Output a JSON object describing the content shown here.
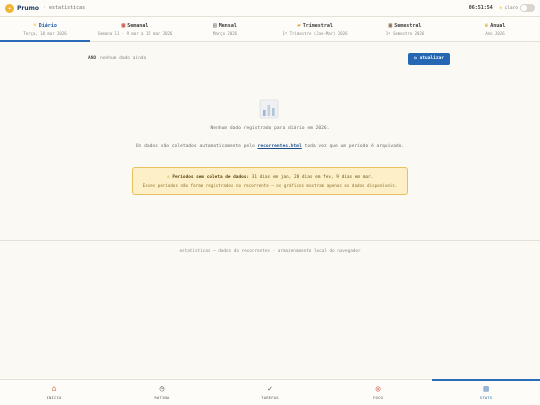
{
  "app": {
    "name": "Prumo",
    "separator": "·",
    "section": "estatísticas"
  },
  "header": {
    "clock": "06:51:54",
    "theme_label": "claro",
    "theme_icon": "sun-icon"
  },
  "tabs": [
    {
      "label": "Diário",
      "sub": "Terça, 10 mar 2026",
      "icon": "sun-icon",
      "active": true
    },
    {
      "label": "Semanal",
      "sub": "Semana 11 · 9 mar a 15 mar 2026",
      "icon": "calendar-icon",
      "active": false
    },
    {
      "label": "Mensal",
      "sub": "Março 2026",
      "icon": "calendar-icon",
      "active": false
    },
    {
      "label": "Trimestral",
      "sub": "1º Trimestre (Jan–Mar) 2026",
      "icon": "folder-icon",
      "active": false
    },
    {
      "label": "Semestral",
      "sub": "1º Semestre 2026",
      "icon": "archive-icon",
      "active": false
    },
    {
      "label": "Anual",
      "sub": "Ano 2026",
      "icon": "trophy-icon",
      "active": false
    }
  ],
  "toolbar": {
    "year_label": "ANO",
    "year_note": "nenhum dado ainda",
    "refresh_label": "↻ atualizar"
  },
  "empty": {
    "message": "Nenhum dado registrado para diário em 2026.",
    "info_prefix": "Os dados são coletados automaticamente pelo",
    "info_link": "recorrentes.html",
    "info_suffix": "toda vez que um período é arquivado."
  },
  "warning": {
    "title": "Períodos sem coleta de dados:",
    "detail": "31 dias em jan, 28 dias em fev, 9 dias em mar.",
    "note": "Esses períodos não foram registrados no recorrente — os gráficos mostram apenas os dados disponíveis."
  },
  "footer": {
    "note": "estatísticas — dados do recorrentes · armazenamento local do navegador"
  },
  "nav": [
    {
      "label": "INÍCIO",
      "icon": "home-icon",
      "active": false
    },
    {
      "label": "ROTINA",
      "icon": "clock-icon",
      "active": false
    },
    {
      "label": "TAREFAS",
      "icon": "check-icon",
      "active": false
    },
    {
      "label": "FOCO",
      "icon": "target-icon",
      "active": false
    },
    {
      "label": "STATS",
      "icon": "chart-icon",
      "active": true
    }
  ],
  "colors": {
    "accent": "#2b6cb8",
    "warning_bg": "#fdf0c8",
    "warning_border": "#e6c15e"
  }
}
